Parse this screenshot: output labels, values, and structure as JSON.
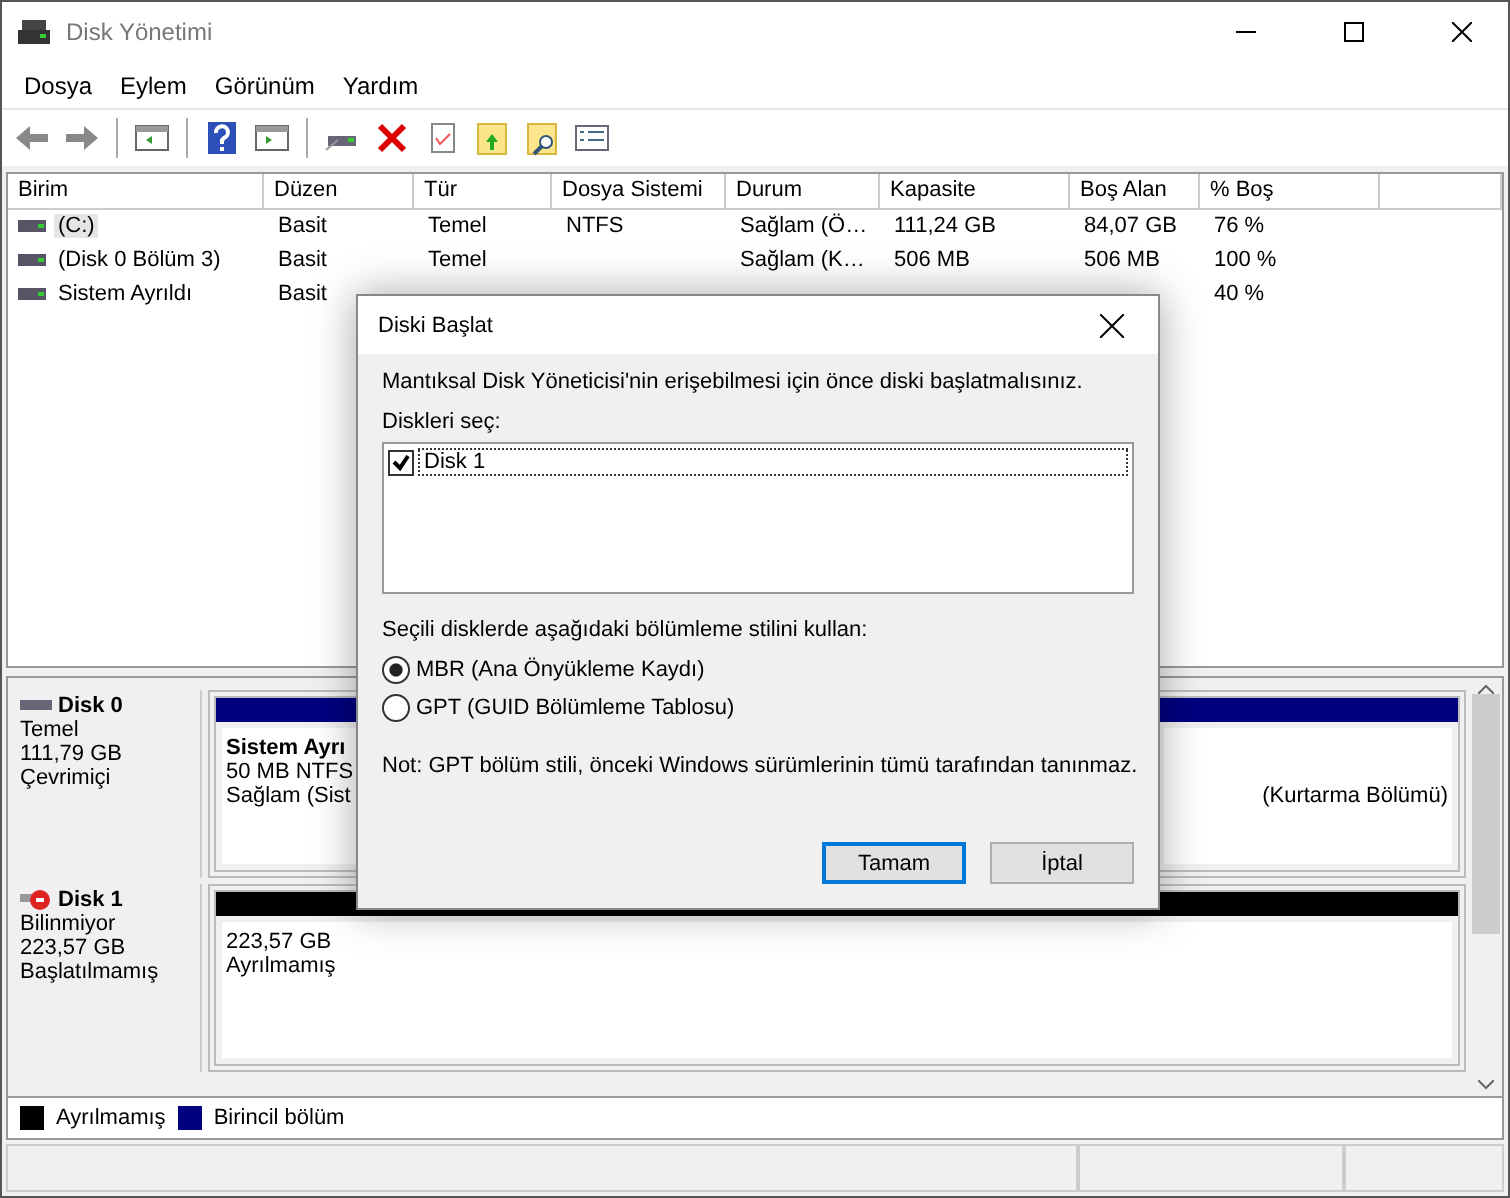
{
  "window": {
    "title": "Disk Yönetimi"
  },
  "menu": [
    "Dosya",
    "Eylem",
    "Görünüm",
    "Yardım"
  ],
  "table": {
    "columns": [
      "Birim",
      "Düzen",
      "Tür",
      "Dosya Sistemi",
      "Durum",
      "Kapasite",
      "Boş Alan",
      "% Boş"
    ],
    "rows": [
      {
        "selected": true,
        "cells": [
          "(C:)",
          "Basit",
          "Temel",
          "NTFS",
          "Sağlam (Ö…",
          "111,24 GB",
          "84,07 GB",
          "76 %"
        ]
      },
      {
        "selected": false,
        "cells": [
          "(Disk 0 Bölüm 3)",
          "Basit",
          "Temel",
          "",
          "Sağlam (K…",
          "506 MB",
          "506 MB",
          "100 %"
        ]
      },
      {
        "selected": false,
        "cells": [
          "Sistem Ayrıldı",
          "Basit",
          "",
          "",
          "",
          "",
          "",
          "40 %"
        ]
      }
    ]
  },
  "disks": [
    {
      "name": "Disk 0",
      "kind": "online",
      "lines": [
        "Temel",
        "111,79 GB",
        "Çevrimiçi"
      ],
      "partitions": [
        {
          "color": "#000080",
          "lines": [
            "Sistem Ayrı",
            "50 MB NTFS",
            "Sağlam (Sist"
          ]
        },
        {
          "color": "#000080",
          "lines": [
            "(Kurtarma Bölümü)"
          ]
        }
      ]
    },
    {
      "name": "Disk 1",
      "kind": "uninitialized",
      "lines": [
        "Bilinmiyor",
        "223,57 GB",
        "Başlatılmamış"
      ],
      "partitions": [
        {
          "color": "#000000",
          "lines": [
            "223,57 GB",
            "Ayrılmamış"
          ]
        }
      ]
    }
  ],
  "legend": [
    {
      "color": "#000000",
      "label": "Ayrılmamış"
    },
    {
      "color": "#000080",
      "label": "Birincil bölüm"
    }
  ],
  "dialog": {
    "title": "Diski Başlat",
    "message": "Mantıksal Disk Yöneticisi'nin erişebilmesi için önce diski başlatmalısınız.",
    "list_label": "Diskleri seç:",
    "disks": [
      {
        "label": "Disk 1",
        "checked": true
      }
    ],
    "style_label": "Seçili disklerde aşağıdaki bölümleme stilini kullan:",
    "styles": [
      {
        "label": "MBR (Ana Önyükleme Kaydı)",
        "selected": true
      },
      {
        "label": "GPT (GUID Bölümleme Tablosu)",
        "selected": false
      }
    ],
    "note": "Not: GPT bölüm stili, önceki Windows sürümlerinin tümü tarafından tanınmaz.",
    "buttons": [
      {
        "label": "Tamam",
        "default": true
      },
      {
        "label": "İptal",
        "default": false
      }
    ]
  }
}
